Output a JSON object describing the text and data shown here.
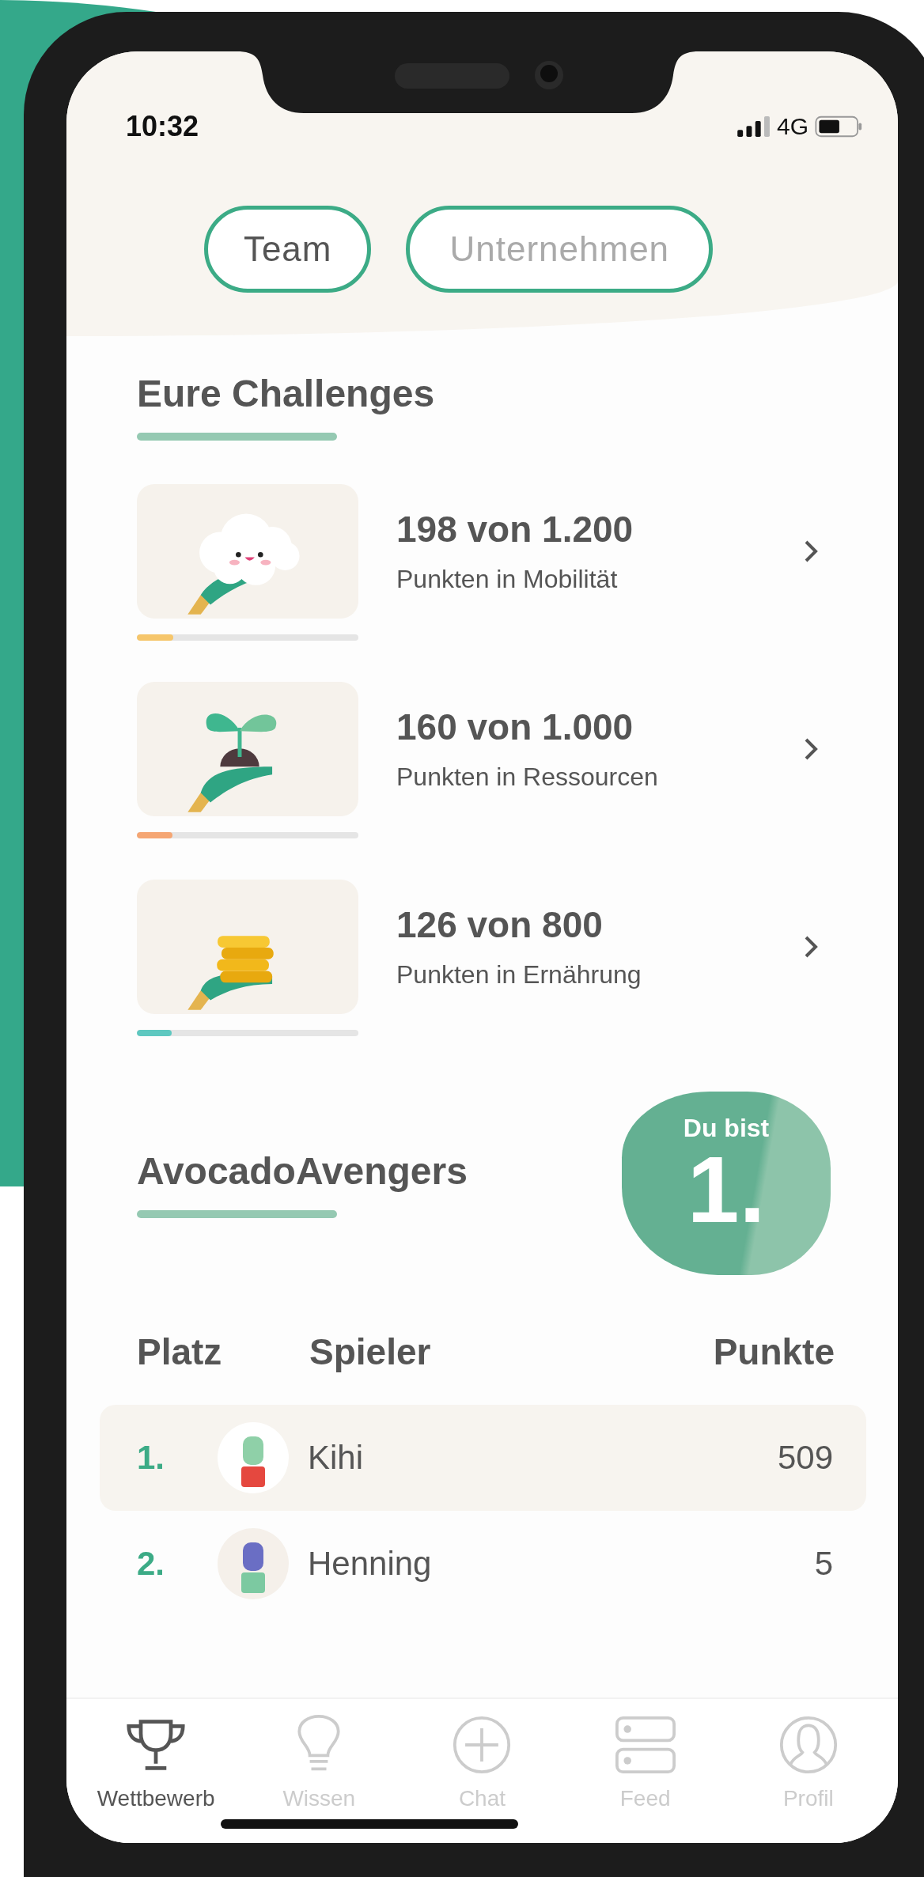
{
  "status_bar": {
    "time": "10:32",
    "network": "4G"
  },
  "tabs": [
    {
      "label": "Team",
      "selected": true
    },
    {
      "label": "Unternehmen",
      "selected": false
    }
  ],
  "challenges": {
    "title": "Eure Challenges",
    "items": [
      {
        "kind": "cloud",
        "title": "198 von 1.200",
        "subtitle": "Punkten in Mobilität",
        "level": 0.165,
        "color": "#f6c66b"
      },
      {
        "kind": "sprout",
        "title": "160 von 1.000",
        "subtitle": "Punkten in Ressourcen",
        "level": 0.16,
        "color": "#f5a673"
      },
      {
        "kind": "coins",
        "title": "126 von 800",
        "subtitle": "Punkten in Ernährung",
        "level": 0.157,
        "color": "#5ec8c0"
      }
    ]
  },
  "team": {
    "name": "AvocadoAvengers",
    "rank_badge": {
      "label": "Du bist",
      "rank": "1."
    }
  },
  "leaderboard": {
    "columns": [
      "Platz",
      "Spieler",
      "Punkte"
    ],
    "rows": [
      {
        "place": "1.",
        "name": "Kihi",
        "points": "509",
        "selected": true
      },
      {
        "place": "2.",
        "name": "Henning",
        "points": "5",
        "selected": false
      }
    ]
  },
  "tab_bar": [
    {
      "kind": "trophy",
      "label": "Wettbewerb",
      "selected": true
    },
    {
      "kind": "bulb",
      "label": "Wissen",
      "selected": false
    },
    {
      "kind": "plus",
      "label": "Chat",
      "selected": false
    },
    {
      "kind": "feed",
      "label": "Feed",
      "selected": false
    },
    {
      "kind": "profile",
      "label": "Profil",
      "selected": false
    }
  ]
}
